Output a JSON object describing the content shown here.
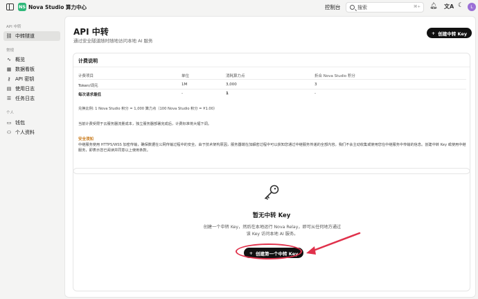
{
  "topbar": {
    "logo_text": "NS",
    "brand": "Nova Studio 算力中心",
    "console": "控制台",
    "search_placeholder": "搜索",
    "search_shortcut": "⌘+",
    "avatar_initial": "L"
  },
  "sidebar": {
    "section1": "API 中转",
    "section2": "常规",
    "section3": "个人",
    "items": [
      {
        "label": "中转隧道",
        "icon": "link-icon"
      },
      {
        "label": "概览",
        "icon": "activity-icon"
      },
      {
        "label": "数据看板",
        "icon": "dashboard-icon"
      },
      {
        "label": "API 密钥",
        "icon": "key-icon"
      },
      {
        "label": "使用日志",
        "icon": "log-icon"
      },
      {
        "label": "任务日志",
        "icon": "task-icon"
      },
      {
        "label": "钱包",
        "icon": "wallet-icon"
      },
      {
        "label": "个人资料",
        "icon": "user-icon"
      }
    ]
  },
  "main": {
    "title": "API 中转",
    "subtitle": "通过安全隧道随时随地访问本地 AI 服务",
    "create_label": "创建中转 Key",
    "billing": {
      "title": "计费说明",
      "headers": [
        "计费项目",
        "单位",
        "消耗算力点",
        "折合 Nova Studio 积分"
      ],
      "rows": [
        [
          "Token/词元",
          "1M",
          "3,000",
          "3"
        ],
        [
          "每次请求最低",
          "-",
          "1",
          "-"
        ]
      ],
      "ratio_note": "兑换比例: 1 Nova Studio 积分 = 1,000 算力点（100 Nova Studio 积分 = ¥1.00）",
      "price_note": "当前计费受限于云服务器流量成本，独立服务器部署完成后，计费标准将大幅下调。",
      "security_title": "安全须知",
      "security_text": "中继服务使用 HTTPS/WSS 加密传输，确保数据在公网传输过程中的安全。由于技术架构原因，服务器端在加解密过程中可以获知您通过中继服务传递的全部内容。我们不会主动收集或使用您在中继服务中传输的信息。创建中转 Key 或使用中继服务，即表示您已阅读并同意以上使用条款。"
    },
    "empty": {
      "title": "暂无中转 Key",
      "desc_line1": "创建一个中转 Key，然后在本地运行 Nova Relay，即可从任何地方通过",
      "desc_line2": "该 Key 访问本地 AI 服务。",
      "button_label": "创建第一个中转 Key"
    }
  },
  "colors": {
    "brand": "#2fb87a",
    "avatar": "#9b6fd6",
    "annotation": "#e0314b",
    "warning": "#f0a030"
  }
}
